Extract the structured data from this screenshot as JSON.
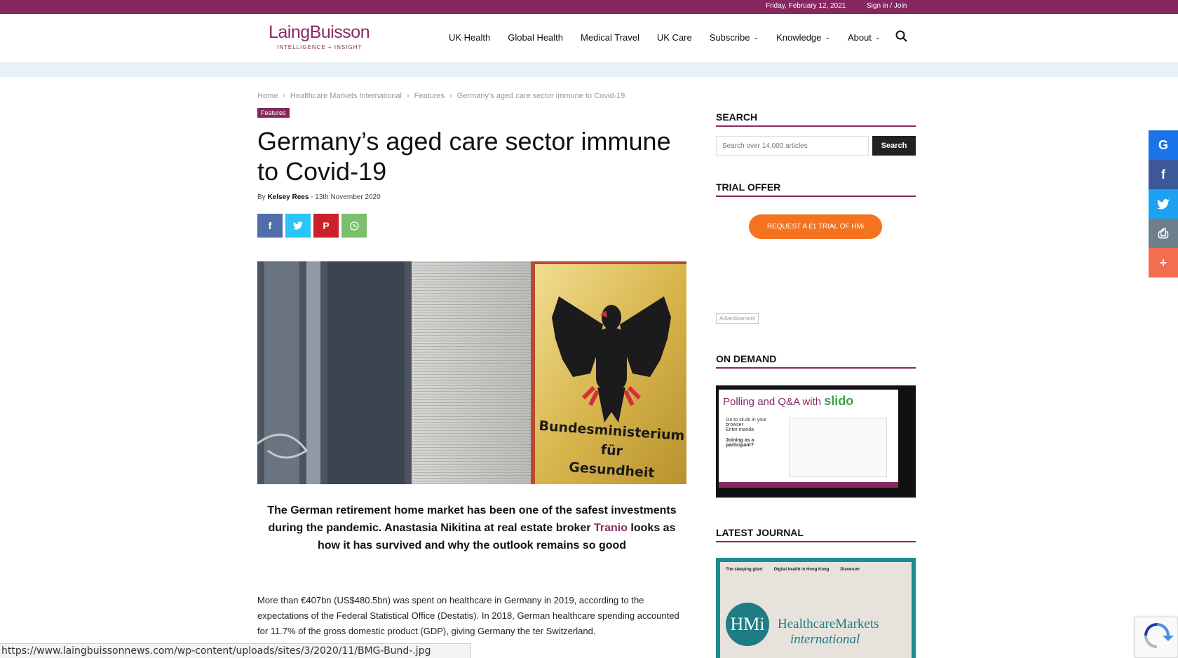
{
  "topbar": {
    "date": "Friday, February 12, 2021",
    "signin": "Sign in / Join"
  },
  "logo": {
    "name": "LaingBuisson",
    "tagline": "INTELLIGENCE + INSIGHT"
  },
  "nav": {
    "items": [
      {
        "label": "UK Health",
        "dropdown": false
      },
      {
        "label": "Global Health",
        "dropdown": false
      },
      {
        "label": "Medical Travel",
        "dropdown": false
      },
      {
        "label": "UK Care",
        "dropdown": false
      },
      {
        "label": "Subscribe",
        "dropdown": true
      },
      {
        "label": "Knowledge",
        "dropdown": true
      },
      {
        "label": "About",
        "dropdown": true
      }
    ],
    "search_icon": "search-icon"
  },
  "breadcrumb": [
    "Home",
    "Healthcare Markets International",
    "Features",
    "Germany’s aged care sector immune to Covid-19"
  ],
  "article": {
    "category": "Features",
    "title": "Germany’s aged care sector immune to Covid-19",
    "by": "By",
    "author": "Kelsey Rees",
    "date": "13th November 2020",
    "share": [
      {
        "name": "facebook",
        "glyph": "f",
        "color": "#516eab"
      },
      {
        "name": "twitter",
        "glyph": "🐦",
        "color": "#29c5f6"
      },
      {
        "name": "pinterest",
        "glyph": "P",
        "color": "#ca212a"
      },
      {
        "name": "whatsapp",
        "glyph": "✆",
        "color": "#7bbf6a"
      }
    ],
    "image_sign_text": [
      "Bundesministerium",
      "für",
      "Gesundheit"
    ],
    "lead_part1": "The German retirement home market has been one of the safest investments during the pandemic. Anastasia Nikitina at real estate broker ",
    "lead_link": "Tranio",
    "lead_part2": " looks as how it has survived and why the outlook remains so good",
    "body": "More than €407bn (US$480.5bn) was spent on healthcare in Germany in 2019, according to the expectations of the Federal Statistical Office (Destatis). In 2018, German healthcare spending accounted for 11.7% of the gross domestic product (GDP), giving Germany the",
    "body_tail": "ter Switzerland."
  },
  "statusbar": {
    "url": "https://www.laingbuissonnews.com/wp-content/uploads/sites/3/2020/11/BMG-Bund-.jpg"
  },
  "sidebar": {
    "search_title": "SEARCH",
    "search_placeholder": "Search over 14,000 articles",
    "search_button": "Search",
    "trial_title": "TRIAL OFFER",
    "trial_button": "REQUEST A £1 TRIAL OF HMi",
    "advert_label": "Advertisement",
    "ondemand_title": "ON DEMAND",
    "ondemand_heading": "Polling and Q&A with ",
    "ondemand_brand": "slido",
    "ondemand_bullets": [
      "Go to sli.do in your browser",
      "Enter manda"
    ],
    "ondemand_join": "Joining as a participant?",
    "journal_title": "LATEST JOURNAL",
    "journal_headlines": [
      "The sleeping giant",
      "Digital health in Hong Kong",
      "Diaverum"
    ],
    "journal_hmi": "HMi",
    "journal_brand": "HealthcareMarkets",
    "journal_brand2": "international"
  },
  "float_share": [
    {
      "name": "google",
      "glyph": "G",
      "color": "#1a73e8"
    },
    {
      "name": "facebook",
      "glyph": "f",
      "color": "#3b5998"
    },
    {
      "name": "twitter",
      "glyph": "🐦",
      "color": "#1da1f2"
    },
    {
      "name": "print",
      "glyph": "⎙",
      "color": "#6d7f8a"
    },
    {
      "name": "more",
      "glyph": "+",
      "color": "#f46d4f"
    }
  ],
  "colors": {
    "brand": "#86285f",
    "accent": "#f37321"
  }
}
